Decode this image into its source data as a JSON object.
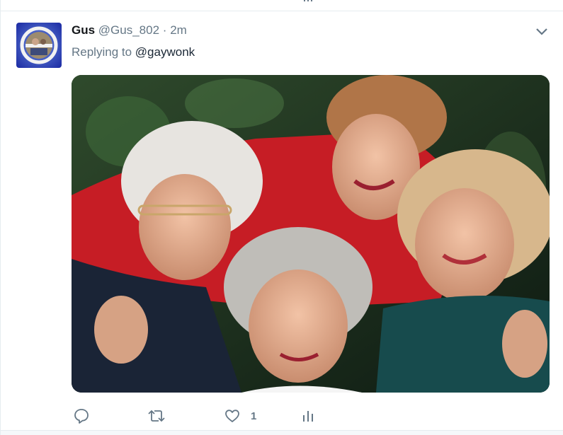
{
  "tweet": {
    "fullname": "Gus",
    "username": "@Gus_802",
    "separator": "·",
    "time": "2m",
    "replying_prefix": "Replying to",
    "replying_to": "@gaywonk",
    "actions": {
      "reply_icon": "reply-icon",
      "retweet_icon": "retweet-icon",
      "like_icon": "heart-icon",
      "like_count": "1",
      "analytics_icon": "analytics-icon"
    }
  },
  "colors": {
    "text_primary": "#14171a",
    "text_secondary": "#657786",
    "border": "#e6ecf0",
    "caret": "#657786"
  }
}
